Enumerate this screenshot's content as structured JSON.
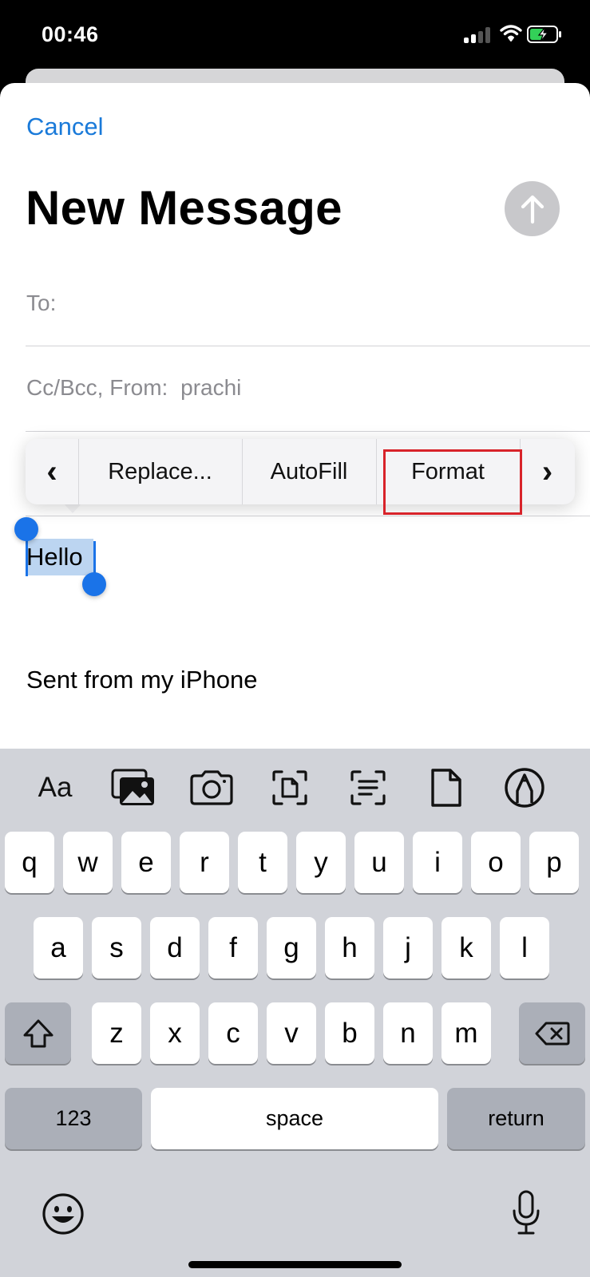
{
  "status_bar": {
    "time": "00:46"
  },
  "compose": {
    "cancel_label": "Cancel",
    "title": "New Message",
    "to_label": "To:",
    "cc_label": "Cc/Bcc, From:",
    "from_value": "prachi",
    "body_selected_text": "Hello",
    "signature": "Sent from my iPhone"
  },
  "edit_menu": {
    "prev_glyph": "‹",
    "items": [
      {
        "label": "Replace..."
      },
      {
        "label": "AutoFill"
      },
      {
        "label": "Format"
      }
    ],
    "next_glyph": "›",
    "highlighted_item": "Format",
    "highlight_color": "#d8232a"
  },
  "keyboard": {
    "toolbar_icons": [
      "text-format-icon",
      "photo-library-icon",
      "camera-icon",
      "scan-document-icon",
      "scan-text-icon",
      "attach-file-icon",
      "markup-icon"
    ],
    "toolbar_aa_label": "Aa",
    "row1": [
      "q",
      "w",
      "e",
      "r",
      "t",
      "y",
      "u",
      "i",
      "o",
      "p"
    ],
    "row2": [
      "a",
      "s",
      "d",
      "f",
      "g",
      "h",
      "j",
      "k",
      "l"
    ],
    "row3": [
      "z",
      "x",
      "c",
      "v",
      "b",
      "n",
      "m"
    ],
    "numbers_label": "123",
    "space_label": "space",
    "return_label": "return",
    "accent_color": "#1a73e8"
  }
}
